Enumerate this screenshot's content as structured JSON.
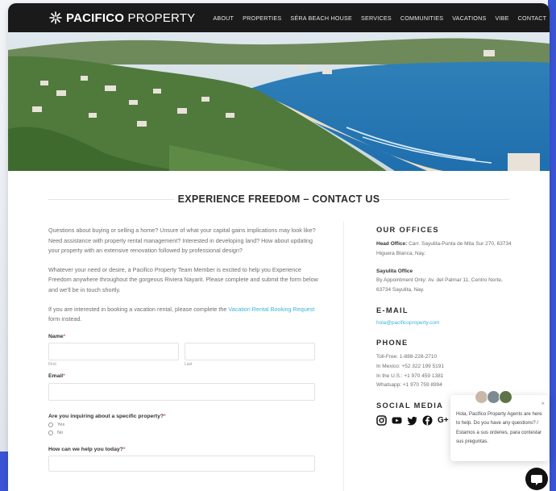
{
  "brand": {
    "logo_bold": "PACIFICO",
    "logo_light": " PROPERTY"
  },
  "nav": {
    "items": [
      "ABOUT",
      "PROPERTIES",
      "SÉRA BEACH HOUSE",
      "SERVICES",
      "COMMUNITIES",
      "VACATIONS",
      "VIBE",
      "CONTACT"
    ]
  },
  "page": {
    "title": "EXPERIENCE FREEDOM – CONTACT US",
    "para1": "Questions about buying or selling a home? Unsure of what your capital gains implications may look like? Need assistance with property rental management? Interested in developing land? How about updating your property with an extensive renovation followed by professional design?",
    "para2": "Whatever your need or desire, a Pacifico Property Team Member is excited to help you Experience Freedom anywhere throughout the gorgeous Riviera Nayarit. Please complete and submit the form below and we'll be in touch shortly.",
    "para3_pre": "If you are interested in booking a vacation rental, please complete the ",
    "para3_link": "Vacation Rental Booking Request",
    "para3_post": " form instead."
  },
  "form": {
    "name_label": "Name",
    "first_label": "First",
    "last_label": "Last",
    "email_label": "Email",
    "property_question": "Are you inquiring about a specific property?",
    "option_yes": "Yes",
    "option_no": "No",
    "help_label": "How can we help you today?",
    "required_mark": "*"
  },
  "offices": {
    "heading": "OUR OFFICES",
    "head_office_label": "Head Office:",
    "head_office_address": " Carr. Sayulita-Punta de Mita Sur 270, 63734 Higuera Blanca, Nay.",
    "sayulita_label": "Sayulita Office",
    "sayulita_address": "By Appointment Only: Av. del Palmar 11, Centro Norte, 63734 Sayulita, Nay."
  },
  "email": {
    "heading": "E-MAIL",
    "address": "hola@pacificoproperty.com"
  },
  "phone": {
    "heading": "PHONE",
    "lines": [
      "Toll-Free: 1-888-228-2710",
      "In Mexico: +52 322 199 5191",
      "In the U.S.: +1 970 459 1381",
      "Whatsapp: +1 970 759 8994"
    ]
  },
  "social": {
    "heading": "SOCIAL MEDIA",
    "icons": [
      "instagram-icon",
      "youtube-icon",
      "twitter-icon",
      "facebook-icon",
      "google-plus-icon"
    ],
    "gplus_text": "G+"
  },
  "chat": {
    "message": "Hola, Pacifico Property Agents are here to help. Do you have any questions? / Estamos a sus ordenes, para contestar sus preguntas.",
    "close": "×"
  },
  "colors": {
    "link": "#3bb4d8",
    "nav_bg": "#1a1a1a",
    "required": "#e25c5c"
  }
}
